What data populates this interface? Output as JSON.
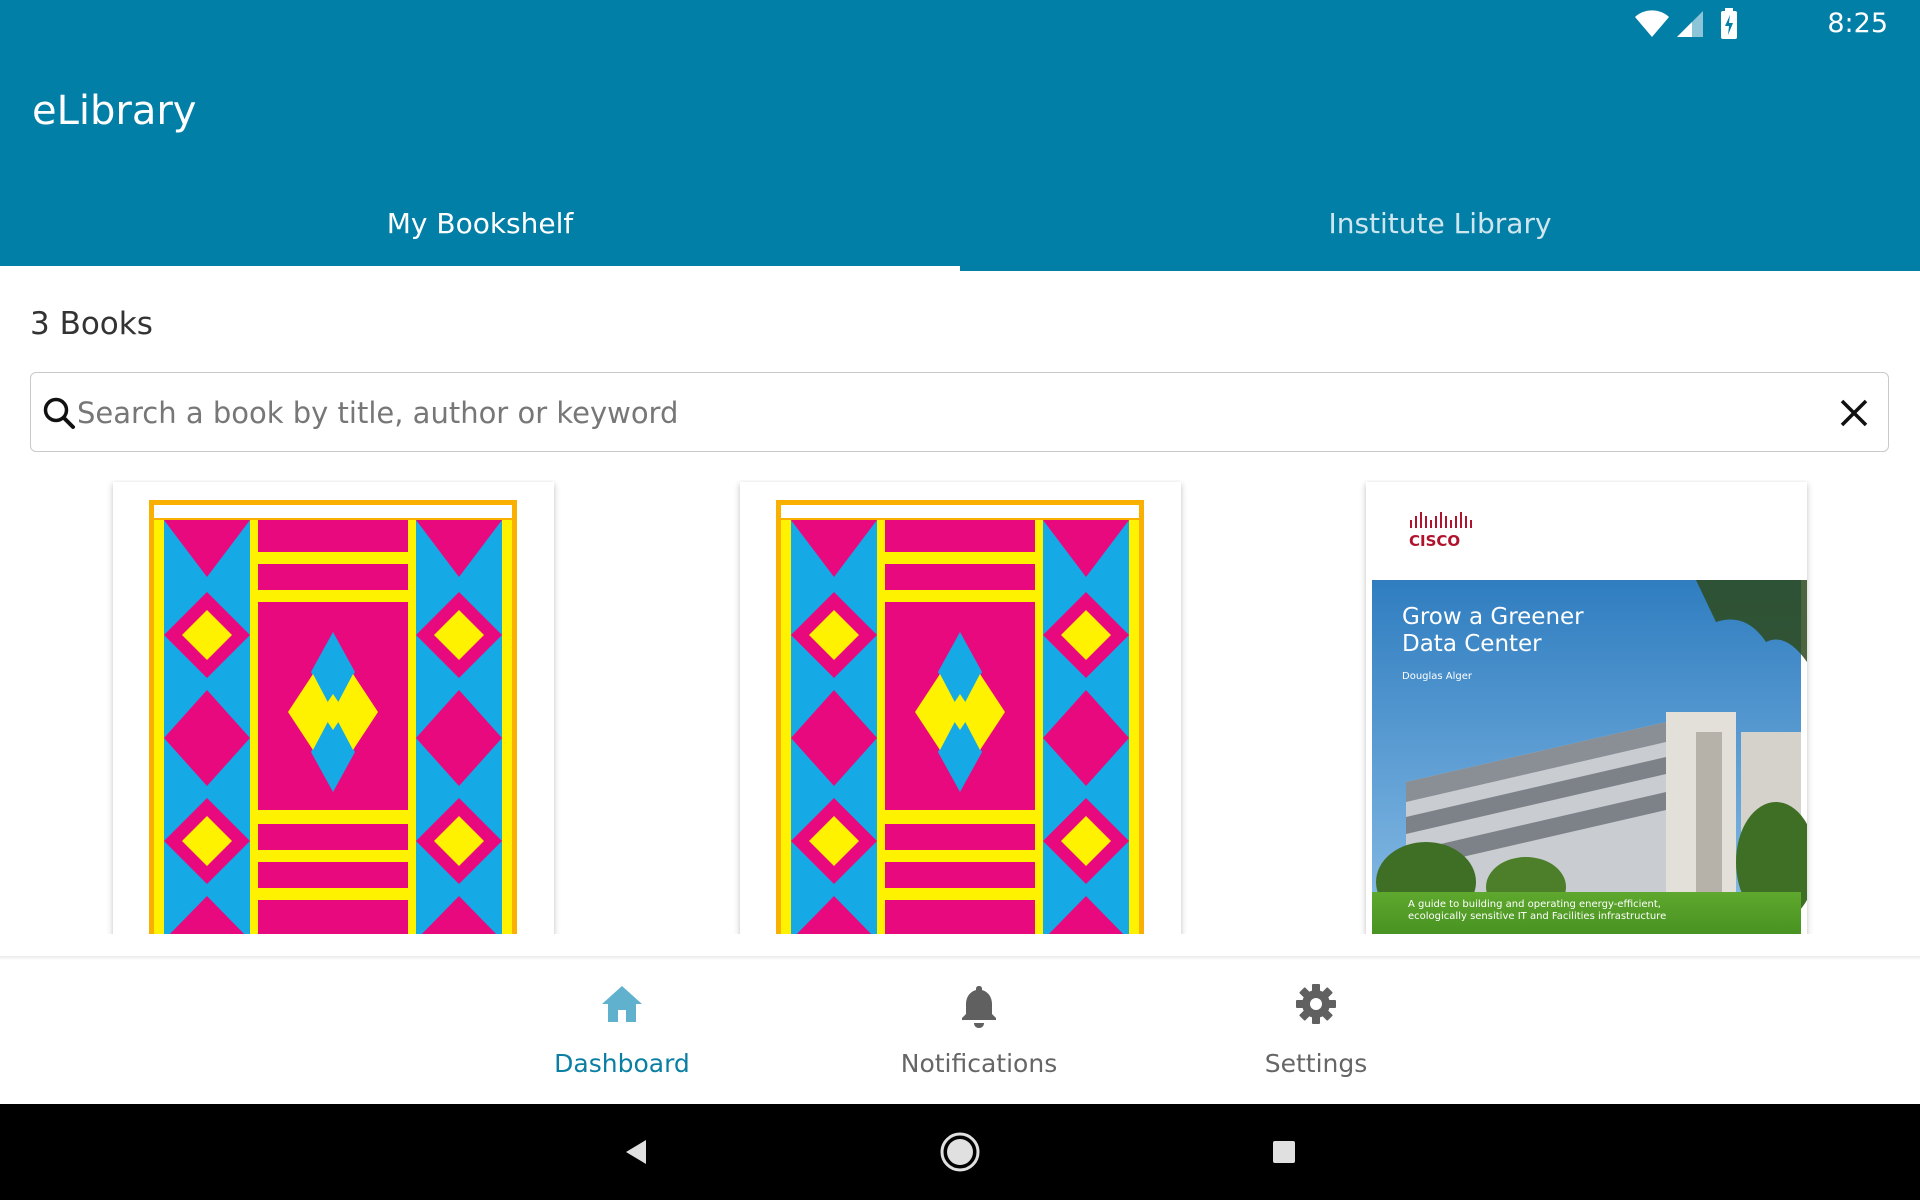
{
  "status_bar": {
    "time": "8:25",
    "icons": [
      "wifi-icon",
      "signal-icon",
      "battery-charging-icon"
    ]
  },
  "app": {
    "title": "eLibrary"
  },
  "tabs": [
    {
      "label": "My Bookshelf",
      "active": true
    },
    {
      "label": "Institute Library",
      "active": false
    }
  ],
  "bookshelf": {
    "count_label": "3 Books",
    "search": {
      "placeholder": "Search a book by title, author or keyword",
      "value": ""
    },
    "books": [
      {
        "cover": "patterned-cover"
      },
      {
        "cover": "patterned-cover"
      },
      {
        "cover": "photo-cover",
        "publisher_logo": "cisco",
        "title": "Grow a Greener Data Center",
        "title_line1": "Grow a Greener",
        "title_line2": "Data Center",
        "author": "Douglas Alger",
        "tagline_line1": "A guide to building and operating energy-efficient,",
        "tagline_line2": "ecologically sensitive IT and Facilities infrastructure"
      }
    ]
  },
  "bottom_nav": [
    {
      "label": "Dashboard",
      "icon": "home-icon",
      "active": true
    },
    {
      "label": "Notifications",
      "icon": "bell-icon",
      "active": false
    },
    {
      "label": "Settings",
      "icon": "gear-icon",
      "active": false
    }
  ],
  "colors": {
    "primary": "#027fa6",
    "active_nav": "#0b7ea4",
    "magenta": "#e9097e",
    "cyan": "#15a9e6",
    "yellow": "#fff200",
    "orange": "#f9b000"
  }
}
